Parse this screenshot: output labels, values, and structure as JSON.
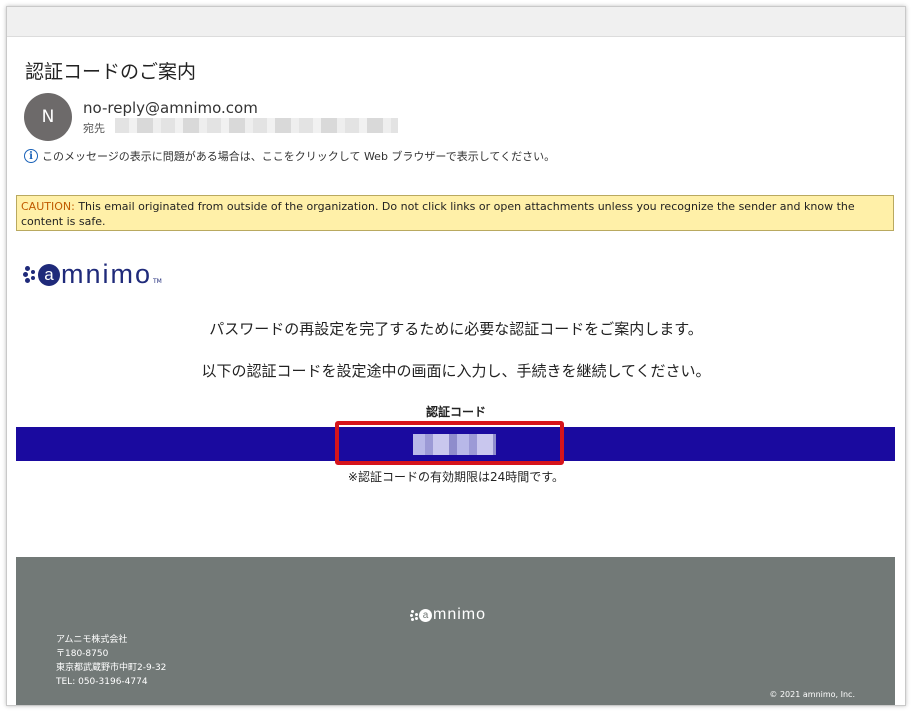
{
  "email": {
    "subject": "認証コードのご案内",
    "avatar_initial": "N",
    "sender": "no-reply@amnimo.com",
    "to_label": "宛先",
    "info_text": "このメッセージの表示に問題がある場合は、ここをクリックして Web ブラウザーで表示してください。"
  },
  "caution": {
    "label": "CAUTION:",
    "text": " This email originated from outside of the organization. Do not click links or open attachments unless you recognize the sender and know the content is safe."
  },
  "body": {
    "logo_letter": "a",
    "logo_text": "mnimo",
    "logo_tm": "TM",
    "message_line1": "パスワードの再設定を完了するために必要な認証コードをご案内します。",
    "message_line2": "以下の認証コードを設定途中の画面に入力し、手続きを継続してください。",
    "code_label": "認証コード",
    "validity_note": "※認証コードの有効期限は24時間です。"
  },
  "footer": {
    "logo_letter": "a",
    "logo_text": "mnimo",
    "company_name": "アムニモ株式会社",
    "postal": "〒180-8750",
    "address": "東京都武蔵野市中町2-9-32",
    "tel": "TEL: 050-3196-4774",
    "copyright": "© 2021 amnimo, Inc."
  },
  "colors": {
    "code_band": "#1a0a9f",
    "highlight_box": "#d6141c",
    "caution_bg": "#fff0a8",
    "footer_bg": "#727977",
    "brand": "#1f2a7a"
  }
}
